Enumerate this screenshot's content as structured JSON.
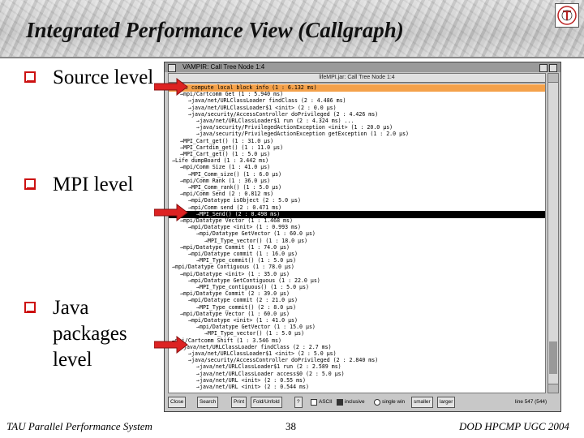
{
  "slide": {
    "title": "Integrated Performance View (Callgraph)",
    "footer_left": "TAU Parallel Performance System",
    "footer_center": "38",
    "footer_right": "DOD HPCMP UGC 2004",
    "bullet_color": "#cc1111",
    "arrow_color": "#dd2222"
  },
  "bullets": [
    {
      "text": "Source level"
    },
    {
      "text": "MPI level"
    },
    {
      "text": "Java packages level"
    }
  ],
  "window": {
    "title": "VAMPIR: Call Tree Node 1:4",
    "inner_title": "lifeMPI.jar: Call Tree Node 1:4",
    "highlight_orange": "#f4a14a",
    "rows": [
      {
        "indent": 0,
        "text": "Life compute local block info (1 : 6.132 ms)"
      },
      {
        "indent": 1,
        "text": "mpi/Cartcomm Get (1 : 5.940 ms)"
      },
      {
        "indent": 2,
        "text": "java/net/URLClassLoader findClass (2 : 4.486 ms)"
      },
      {
        "indent": 2,
        "text": "java/net/URLClassLoader$1 <init> (2 : 0.0 µs)"
      },
      {
        "indent": 2,
        "text": "java/security/AccessController doPrivileged (2 : 4.426 ms)"
      },
      {
        "indent": 3,
        "text": "java/net/URLClassLoader$1 run (2 : 4.324 ms) ..."
      },
      {
        "indent": 3,
        "text": "java/security/PrivilegedActionException <init> (1 : 20.0 µs)"
      },
      {
        "indent": 3,
        "text": "java/security/PrivilegedActionException getException (1 : 2.0 µs)"
      },
      {
        "indent": 1,
        "text": "MPI_Cart_get() (1 : 31.0 µs)"
      },
      {
        "indent": 1,
        "text": "MPI_Cartdim_get() (1 : 11.0 µs)"
      },
      {
        "indent": 1,
        "text": "MPI_Cart_get() (1 : 5.0 µs)"
      },
      {
        "indent": 0,
        "text": "Life dumpBoard (1 : 3.442 ms)"
      },
      {
        "indent": 1,
        "text": "mpi/Comm Size (1 : 41.0 µs)"
      },
      {
        "indent": 2,
        "text": "MPI_Comm_size() (1 : 6.0 µs)"
      },
      {
        "indent": 1,
        "text": "mpi/Comm Rank (1 : 36.0 µs)"
      },
      {
        "indent": 2,
        "text": "MPI_Comm_rank() (1 : 5.0 µs)"
      },
      {
        "indent": 1,
        "text": "mpi/Comm Send (2 : 0.812 ms)"
      },
      {
        "indent": 2,
        "text": "mpi/Datatype isObject (2 : 5.0 µs)"
      },
      {
        "indent": 2,
        "text": "mpi/Comm send (2 : 0.471 ms)"
      },
      {
        "indent": 3,
        "text": "MPI_Send() (2 : 0.498 ms)",
        "highlight": "black"
      },
      {
        "indent": 1,
        "text": "mpi/Datatype Vector (1 : 1.468 ms)"
      },
      {
        "indent": 2,
        "text": "mpi/Datatype <init> (1 : 0.993 ms)"
      },
      {
        "indent": 3,
        "text": "mpi/Datatype GetVector (1 : 60.0 µs)"
      },
      {
        "indent": 4,
        "text": "MPI_Type_vector() (1 : 18.0 µs)"
      },
      {
        "indent": 1,
        "text": "mpi/Datatype Commit (1 : 74.0 µs)"
      },
      {
        "indent": 2,
        "text": "mpi/Datatype commit (1 : 16.0 µs)"
      },
      {
        "indent": 3,
        "text": "MPI_Type_commit() (1 : 5.0 µs)"
      },
      {
        "indent": 0,
        "text": "mpi/Datatype Contiguous (1 : 78.0 µs)"
      },
      {
        "indent": 1,
        "text": "mpi/Datatype <init> (1 : 35.0 µs)"
      },
      {
        "indent": 2,
        "text": "mpi/Datatype GetContiguous (1 : 22.0 µs)"
      },
      {
        "indent": 3,
        "text": "MPI_Type_contiguous() (1 : 5.0 µs)"
      },
      {
        "indent": 1,
        "text": "mpi/Datatype Commit (2 : 39.0 µs)"
      },
      {
        "indent": 2,
        "text": "mpi/Datatype commit (2 : 21.0 µs)"
      },
      {
        "indent": 3,
        "text": "MPI_Type_commit() (2 : 8.0 µs)"
      },
      {
        "indent": 1,
        "text": "mpi/Datatype Vector (1 : 60.0 µs)"
      },
      {
        "indent": 2,
        "text": "mpi/Datatype <init> (1 : 41.0 µs)"
      },
      {
        "indent": 3,
        "text": "mpi/Datatype GetVector (1 : 15.0 µs)"
      },
      {
        "indent": 4,
        "text": "MPI_Type_vector() (1 : 5.0 µs)"
      },
      {
        "indent": 0,
        "text": "mpi/Cartcomm Shift (1 : 3.546 ms)"
      },
      {
        "indent": 1,
        "text": "java/net/URLClassLoader findClass (2 : 2.7 ms)"
      },
      {
        "indent": 2,
        "text": "java/net/URLClassLoader$1 <init> (2 : 5.0 µs)"
      },
      {
        "indent": 2,
        "text": "java/security/AccessController doPrivileged (2 : 2.840 ms)"
      },
      {
        "indent": 3,
        "text": "java/net/URLClassLoader$1 run (2 : 2.589 ms)"
      },
      {
        "indent": 3,
        "text": "java/net/URLClassLoader access$0 (2 : 5.0 µs)"
      },
      {
        "indent": 3,
        "text": "java/net/URL <init> (2 : 0.55 ms)"
      },
      {
        "indent": 3,
        "text": "java/net/URL <init> (2 : 0.544 ms)"
      }
    ],
    "toolbar": {
      "close": "Close",
      "search": "Search",
      "print": "Print",
      "fold_unfold": "Fold/Unfold",
      "question": "?",
      "ascii": "ASCII",
      "inclusive": "inclusive",
      "single_win": "single win",
      "smaller": "smaller",
      "larger": "larger",
      "line_status": "line 547 (544)"
    }
  }
}
